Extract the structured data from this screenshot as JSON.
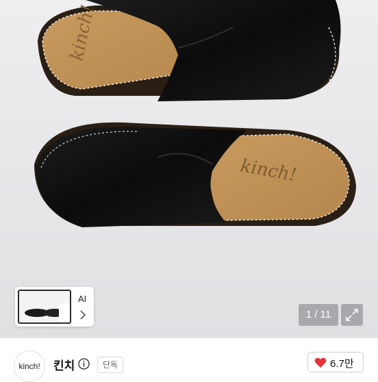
{
  "hero": {
    "image_alt": "black leather mules",
    "brand_print": "kinch!"
  },
  "thumbnail": {
    "ai_label": "AI",
    "chevron_icon": "chevron-right-icon"
  },
  "gallery": {
    "counter": "1 / 11",
    "expand_icon": "expand-icon"
  },
  "seller": {
    "avatar_text": "kinch!",
    "name": "킨치",
    "info_icon": "info-icon",
    "badge": "단독"
  },
  "like": {
    "heart_icon": "heart-icon",
    "count": "6.7만",
    "color": "#e8323c"
  }
}
